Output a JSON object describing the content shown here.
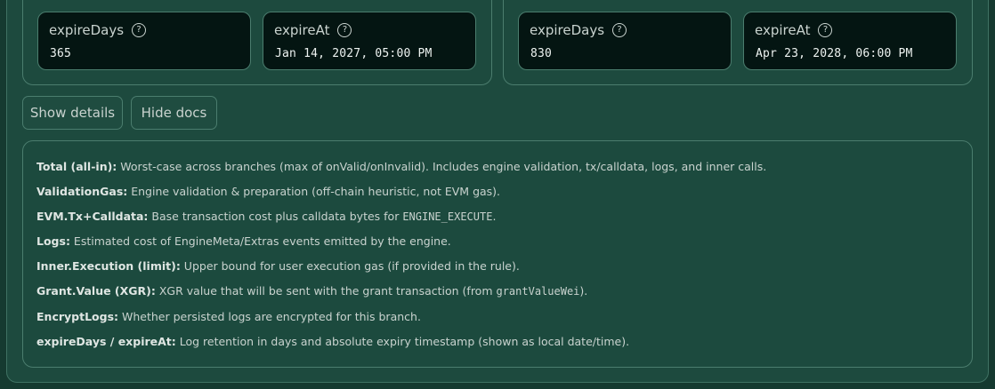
{
  "branches": [
    {
      "expireDays": {
        "label": "expireDays",
        "value": "365"
      },
      "expireAt": {
        "label": "expireAt",
        "value": "Jan 14, 2027, 05:00 PM"
      }
    },
    {
      "expireDays": {
        "label": "expireDays",
        "value": "830"
      },
      "expireAt": {
        "label": "expireAt",
        "value": "Apr 23, 2028, 06:00 PM"
      }
    }
  ],
  "help_icon_glyph": "?",
  "icons": {
    "help": "question-circle-icon"
  },
  "buttons": {
    "show_details": "Show details",
    "hide_docs": "Hide docs"
  },
  "docs": [
    {
      "term": "Total (all-in):",
      "text": " Worst-case across branches (max of onValid/onInvalid). Includes engine validation, tx/calldata, logs, and inner calls."
    },
    {
      "term": "ValidationGas:",
      "text": " Engine validation & preparation (off-chain heuristic, not EVM gas)."
    },
    {
      "term": "EVM.Tx+Calldata:",
      "text": " Base transaction cost plus calldata bytes for ",
      "code": "ENGINE_EXECUTE",
      "text_after": "."
    },
    {
      "term": "Logs:",
      "text": " Estimated cost of EngineMeta/Extras events emitted by the engine."
    },
    {
      "term": "Inner.Execution (limit):",
      "text": " Upper bound for user execution gas (if provided in the rule)."
    },
    {
      "term": "Grant.Value (XGR):",
      "text": " XGR value that will be sent with the grant transaction (from ",
      "code": "grantValueWei",
      "text_after": ")."
    },
    {
      "term": "EncryptLogs:",
      "text": " Whether persisted logs are encrypted for this branch."
    },
    {
      "term": "expireDays / expireAt:",
      "text": " Log retention in days and absolute expiry timestamp (shown as local date/time)."
    }
  ]
}
